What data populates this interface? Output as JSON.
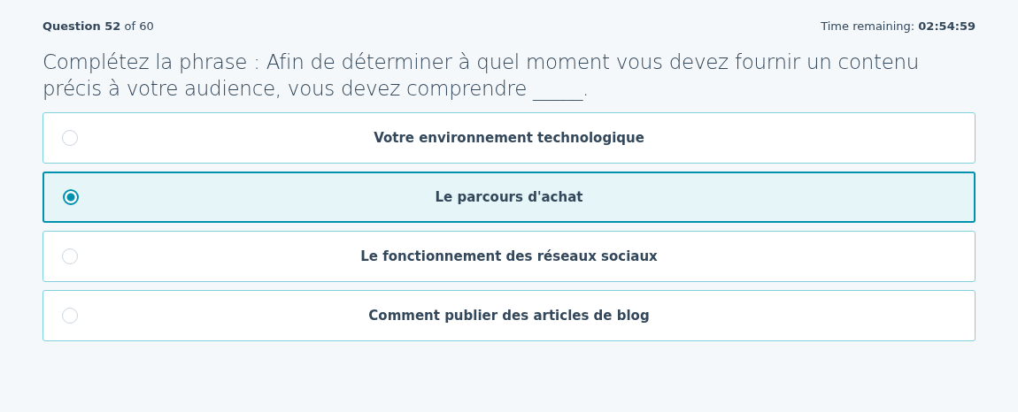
{
  "header": {
    "progress": "**Question 52** of 60",
    "timer": "Time remaining: **02:54:59**"
  },
  "question": "Complétez la phrase : Afin de déterminer à quel moment vous devez fournir un contenu précis à votre audience, vous devez comprendre _____.",
  "options": [
    {
      "label": "Votre environnement technologique",
      "selected": false
    },
    {
      "label": "Le parcours d'achat",
      "selected": true
    },
    {
      "label": "Le fonctionnement des réseaux sociaux",
      "selected": false
    },
    {
      "label": "Comment publier des articles de blog",
      "selected": false
    }
  ]
}
